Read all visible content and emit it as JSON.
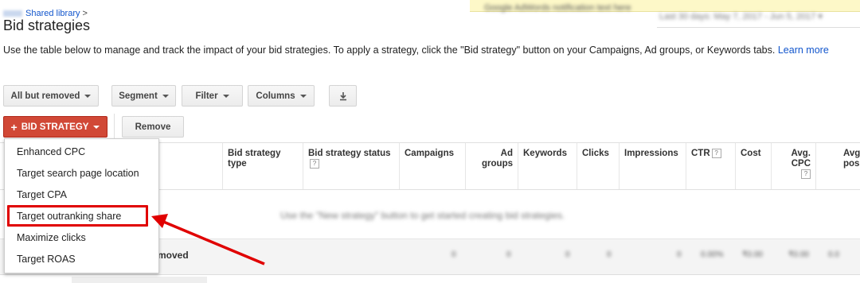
{
  "breadcrumb": {
    "link": "Shared library",
    "separator": ">"
  },
  "page_title": "Bid strategies",
  "description": {
    "text": "Use the table below to manage and track the impact of your bid strategies. To apply a strategy, click the \"Bid strategy\" button on your Campaigns, Ad groups, or Keywords tabs.",
    "link": "Learn more"
  },
  "toolbar": {
    "filter_status": "All but removed",
    "segment": "Segment",
    "filter": "Filter",
    "columns": "Columns",
    "bid_strategy": "BID STRATEGY",
    "remove": "Remove"
  },
  "bid_strategy_menu": [
    "Enhanced CPC",
    "Target search page location",
    "Target CPA",
    "Target outranking share",
    "Maximize clicks",
    "Target ROAS"
  ],
  "table": {
    "columns": [
      "Bid strategy type",
      "Bid strategy status",
      "Campaigns",
      "Ad groups",
      "Keywords",
      "Clicks",
      "Impressions",
      "CTR",
      "Cost",
      "Avg. CPC",
      "Avg. position"
    ],
    "help_mark": "?",
    "total_label": "moved"
  },
  "annotation": {
    "highlight_color": "#e00000",
    "highlighted_item": "Target outranking share"
  },
  "colors": {
    "bid_button": "#d14836",
    "link": "#1155cc"
  },
  "icons": {
    "download": "download-icon",
    "plus": "plus-icon"
  }
}
